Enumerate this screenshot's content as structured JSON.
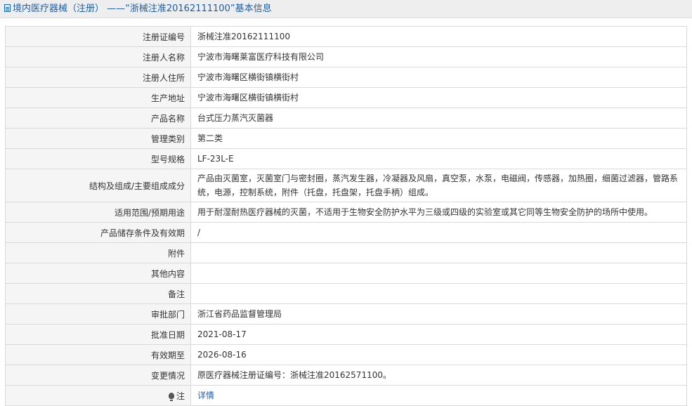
{
  "header": {
    "title": "境内医疗器械（注册） ——“浙械注准20162111100”基本信息",
    "icon": "document-icon"
  },
  "rows": [
    {
      "label": "注册证编号",
      "value": "浙械注准20162111100"
    },
    {
      "label": "注册人名称",
      "value": "宁波市海曙莱富医疗科技有限公司"
    },
    {
      "label": "注册人住所",
      "value": "宁波市海曙区横街镇横街村"
    },
    {
      "label": "生产地址",
      "value": "宁波市海曙区横街镇横街村"
    },
    {
      "label": "产品名称",
      "value": "台式压力蒸汽灭菌器"
    },
    {
      "label": "管理类别",
      "value": "第二类"
    },
    {
      "label": "型号规格",
      "value": "LF-23L-E"
    },
    {
      "label": "结构及组成/主要组成成分",
      "value": "产品由灭菌室，灭菌室门与密封圈，蒸汽发生器，冷凝器及风扇，真空泵，水泵，电磁阀，传感器，加热圈，细菌过滤器，管路系统，电源，控制系统，附件（托盘，托盘架，托盘手柄）组成。"
    },
    {
      "label": "适用范围/预期用途",
      "value": "用于耐湿耐热医疗器械的灭菌，不适用于生物安全防护水平为三级或四级的实验室或其它同等生物安全防护的场所中使用。"
    },
    {
      "label": "产品储存条件及有效期",
      "value": "/"
    },
    {
      "label": "附件",
      "value": ""
    },
    {
      "label": "其他内容",
      "value": ""
    },
    {
      "label": "备注",
      "value": ""
    },
    {
      "label": "审批部门",
      "value": "浙江省药品监督管理局"
    },
    {
      "label": "批准日期",
      "value": "2021-08-17"
    },
    {
      "label": "有效期至",
      "value": "2026-08-16"
    },
    {
      "label": "变更情况",
      "value": "原医疗器械注册证编号：浙械注准20162571100。"
    }
  ],
  "note_row": {
    "label": "注",
    "link": "详情",
    "icon": "lightbulb-icon"
  },
  "colors": {
    "link": "#1a5fa8",
    "label_bg": "#f5f5f5",
    "border": "#d9d9d9"
  }
}
